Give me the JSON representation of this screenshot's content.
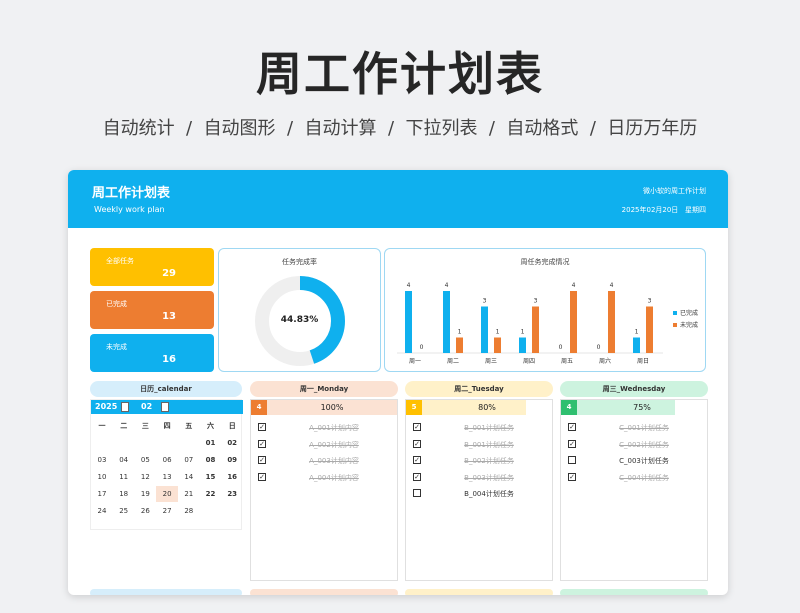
{
  "hero": {
    "title": "周工作计划表"
  },
  "features": [
    "自动统计",
    "自动图形",
    "自动计算",
    "下拉列表",
    "自动格式",
    "日历万年历"
  ],
  "header": {
    "title": "周工作计划表",
    "subtitle": "Weekly work plan",
    "owner": "微小软的周工作计划",
    "date": "2025年02月20日",
    "weekday": "星期四"
  },
  "stats": [
    {
      "label": "全部任务",
      "value": "29",
      "color": "#ffc000"
    },
    {
      "label": "已完成",
      "value": "13",
      "color": "#ed7d31"
    },
    {
      "label": "未完成",
      "value": "16",
      "color": "#0fb0ee"
    }
  ],
  "donut": {
    "title": "任务完成率",
    "label": "44.83%",
    "percent": 44.83
  },
  "chart_data": {
    "type": "bar",
    "title": "周任务完成情况",
    "categories": [
      "周一",
      "周二",
      "周三",
      "周四",
      "周五",
      "周六",
      "周日"
    ],
    "series": [
      {
        "name": "已完成",
        "values": [
          4,
          4,
          3,
          1,
          0,
          0,
          1
        ],
        "color": "#0fb0ee"
      },
      {
        "name": "未完成",
        "values": [
          0,
          1,
          1,
          3,
          4,
          4,
          3
        ],
        "color": "#ed7d31"
      }
    ],
    "ylim": [
      0,
      4
    ],
    "legend": "right"
  },
  "calendar": {
    "title": "日历_calendar",
    "year": "2025",
    "month": "02",
    "weekdays": [
      "一",
      "二",
      "三",
      "四",
      "五",
      "六",
      "日"
    ],
    "rows": [
      [
        "",
        "",
        "",
        "",
        "",
        "01",
        "02"
      ],
      [
        "03",
        "04",
        "05",
        "06",
        "07",
        "08",
        "09"
      ],
      [
        "10",
        "11",
        "12",
        "13",
        "14",
        "15",
        "16"
      ],
      [
        "17",
        "18",
        "19",
        "20",
        "21",
        "22",
        "23"
      ],
      [
        "24",
        "25",
        "26",
        "27",
        "28",
        "",
        ""
      ]
    ],
    "today": "20"
  },
  "days": [
    {
      "title": "周一_Monday",
      "count": "4",
      "pct_label": "100%",
      "pct": 100,
      "head_bg": "#fbe2d3",
      "accent": "#ed7d31",
      "fill": "#fbe2d3",
      "tasks": [
        {
          "text": "A_001计划内容",
          "done": true
        },
        {
          "text": "A_002计划内容",
          "done": true
        },
        {
          "text": "A_003计划内容",
          "done": true
        },
        {
          "text": "A_004计划内容",
          "done": true
        }
      ]
    },
    {
      "title": "周二_Tuesday",
      "count": "5",
      "pct_label": "80%",
      "pct": 80,
      "head_bg": "#fff1c9",
      "accent": "#ffc000",
      "fill": "#fff1c9",
      "tasks": [
        {
          "text": "B_001计划任务",
          "done": true
        },
        {
          "text": "B_001计划任务",
          "done": true
        },
        {
          "text": "B_002计划任务",
          "done": true
        },
        {
          "text": "B_003计划任务",
          "done": true
        },
        {
          "text": "B_004计划任务",
          "done": false
        }
      ]
    },
    {
      "title": "周三_Wednesday",
      "count": "4",
      "pct_label": "75%",
      "pct": 75,
      "head_bg": "#cdf3df",
      "accent": "#2fbf6f",
      "fill": "#cdf3df",
      "tasks": [
        {
          "text": "C_001计划任务",
          "done": true
        },
        {
          "text": "C_002计划任务",
          "done": true
        },
        {
          "text": "C_003计划任务",
          "done": false
        },
        {
          "text": "C_004计划任务",
          "done": true
        }
      ]
    }
  ]
}
